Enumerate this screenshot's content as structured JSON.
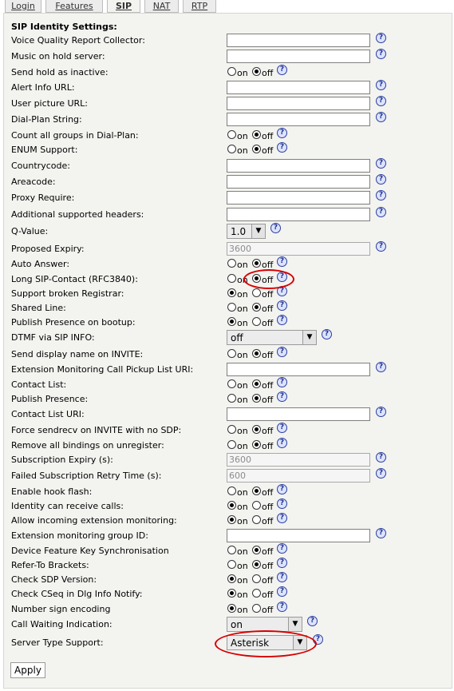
{
  "tabs": [
    {
      "label": "Login",
      "active": false
    },
    {
      "label": "Features",
      "active": false
    },
    {
      "label": "SIP",
      "active": true
    },
    {
      "label": "NAT",
      "active": false
    },
    {
      "label": "RTP",
      "active": false
    }
  ],
  "heading": "SIP Identity Settings:",
  "help_glyph": "?",
  "radio_labels": {
    "on": "on",
    "off": "off"
  },
  "select_arrow": "▼",
  "rows": [
    {
      "label": "Voice Quality Report Collector:",
      "type": "text",
      "value": ""
    },
    {
      "label": "Music on hold server:",
      "type": "text",
      "value": ""
    },
    {
      "label": "Send hold as inactive:",
      "type": "radio",
      "value": "off"
    },
    {
      "label": "Alert Info URL:",
      "type": "text",
      "value": ""
    },
    {
      "label": "User picture URL:",
      "type": "text",
      "value": ""
    },
    {
      "label": "Dial-Plan String:",
      "type": "text",
      "value": ""
    },
    {
      "label": "Count all groups in Dial-Plan:",
      "type": "radio",
      "value": "off"
    },
    {
      "label": "ENUM Support:",
      "type": "radio",
      "value": "off"
    },
    {
      "label": "Countrycode:",
      "type": "text",
      "value": ""
    },
    {
      "label": "Areacode:",
      "type": "text",
      "value": ""
    },
    {
      "label": "Proxy Require:",
      "type": "text",
      "value": ""
    },
    {
      "label": "Additional supported headers:",
      "type": "text",
      "value": ""
    },
    {
      "label": "Q-Value:",
      "type": "select",
      "value": "1.0"
    },
    {
      "label": "Proposed Expiry:",
      "type": "text",
      "value": "3600",
      "disabled": true
    },
    {
      "label": "Auto Answer:",
      "type": "radio",
      "value": "off"
    },
    {
      "label": "Long SIP-Contact (RFC3840):",
      "type": "radio",
      "value": "off"
    },
    {
      "label": "Support broken Registrar:",
      "type": "radio",
      "value": "on"
    },
    {
      "label": "Shared Line:",
      "type": "radio",
      "value": "off"
    },
    {
      "label": "Publish Presence on bootup:",
      "type": "radio",
      "value": "on"
    },
    {
      "label": "DTMF via SIP INFO:",
      "type": "select",
      "value": "off"
    },
    {
      "label": "Send display name on INVITE:",
      "type": "radio",
      "value": "off"
    },
    {
      "label": "Extension Monitoring Call Pickup List URI:",
      "type": "text",
      "value": ""
    },
    {
      "label": "Contact List:",
      "type": "radio",
      "value": "off"
    },
    {
      "label": "Publish Presence:",
      "type": "radio",
      "value": "off"
    },
    {
      "label": "Contact List URI:",
      "type": "text",
      "value": ""
    },
    {
      "label": "Force sendrecv on INVITE with no SDP:",
      "type": "radio",
      "value": "off"
    },
    {
      "label": "Remove all bindings on unregister:",
      "type": "radio",
      "value": "off"
    },
    {
      "label": "Subscription Expiry (s):",
      "type": "text",
      "value": "3600",
      "disabled": true
    },
    {
      "label": "Failed Subscription Retry Time (s):",
      "type": "text",
      "value": "600",
      "disabled": true
    },
    {
      "label": "Enable hook flash:",
      "type": "radio",
      "value": "off"
    },
    {
      "label": "Identity can receive calls:",
      "type": "radio",
      "value": "on"
    },
    {
      "label": "Allow incoming extension monitoring:",
      "type": "radio",
      "value": "on"
    },
    {
      "label": "Extension monitoring group ID:",
      "type": "text",
      "value": ""
    },
    {
      "label": "Device Feature Key Synchronisation",
      "type": "radio",
      "value": "off"
    },
    {
      "label": "Refer-To Brackets:",
      "type": "radio",
      "value": "off"
    },
    {
      "label": "Check SDP Version:",
      "type": "radio",
      "value": "on"
    },
    {
      "label": "Check CSeq in Dlg Info Notify:",
      "type": "radio",
      "value": "on"
    },
    {
      "label": "Number sign encoding",
      "type": "radio",
      "value": "on"
    },
    {
      "label": "Call Waiting Indication:",
      "type": "select",
      "value": "on"
    },
    {
      "label": "Server Type Support:",
      "type": "select",
      "value": "Asterisk"
    }
  ],
  "apply_label": "Apply",
  "colors": {
    "annotation": "#d60000",
    "panel": "#f3f3f0",
    "help": "#2a3f9f"
  }
}
